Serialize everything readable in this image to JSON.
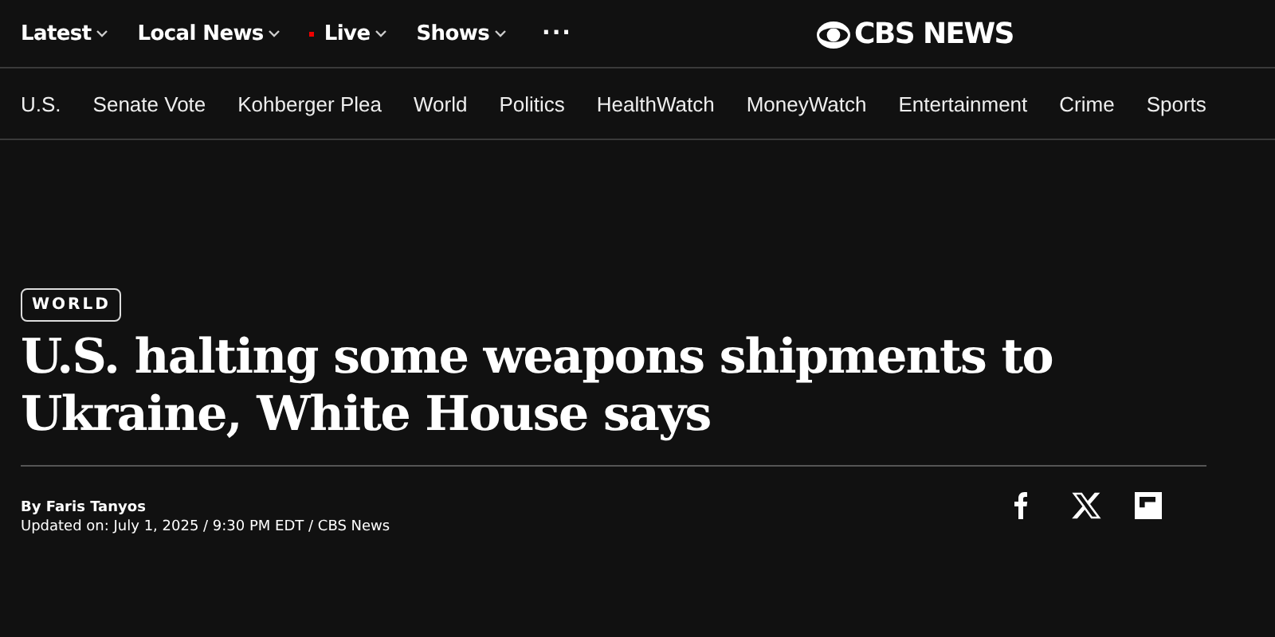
{
  "top_nav": {
    "items": [
      {
        "label": "Latest",
        "kind": "menu"
      },
      {
        "label": "Local News",
        "kind": "menu"
      },
      {
        "label": "Live",
        "kind": "live"
      },
      {
        "label": "Shows",
        "kind": "menu"
      }
    ],
    "more": "···",
    "logo": "CBS NEWS"
  },
  "section_nav": [
    "U.S.",
    "Senate Vote",
    "Kohberger Plea",
    "World",
    "Politics",
    "HealthWatch",
    "MoneyWatch",
    "Entertainment",
    "Crime",
    "Sports"
  ],
  "article": {
    "tag": "WORLD",
    "headline": "U.S. halting some weapons shipments to Ukraine, White House says",
    "byline": "By Faris Tanyos",
    "updated": "Updated on: July 1, 2025 / 9:30 PM EDT / CBS News"
  },
  "share": [
    {
      "kind": "facebook"
    },
    {
      "kind": "x"
    },
    {
      "kind": "flipboard"
    }
  ]
}
